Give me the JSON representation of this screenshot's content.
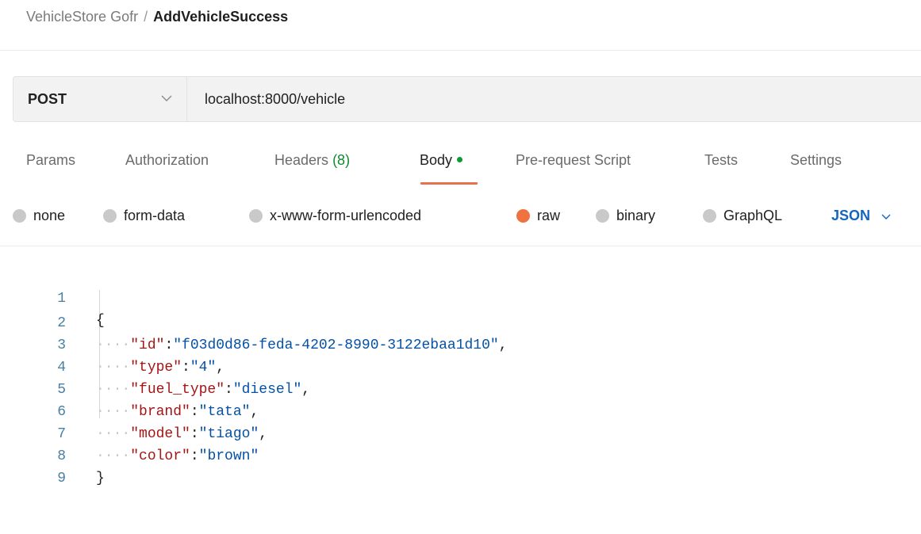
{
  "breadcrumb": {
    "collection": "VehicleStore Gofr",
    "separator": "/",
    "request_name": "AddVehicleSuccess"
  },
  "request": {
    "method": "POST",
    "method_dropdown_icon": "chevron-down-icon",
    "url": "localhost:8000/vehicle"
  },
  "tabs": {
    "params": "Params",
    "authorization": "Authorization",
    "headers_label": "Headers",
    "headers_count": "(8)",
    "body": "Body",
    "pre_request_script": "Pre-request Script",
    "tests": "Tests",
    "settings": "Settings",
    "active": "Body"
  },
  "body_types": {
    "none": "none",
    "form_data": "form-data",
    "x_www_form_urlencoded": "x-www-form-urlencoded",
    "raw": "raw",
    "binary": "binary",
    "graphql": "GraphQL",
    "selected": "raw",
    "format": "JSON"
  },
  "colors": {
    "accent_orange": "#f07240",
    "json_blue": "#1565c0",
    "headers_count_green": "#0e8a2f",
    "json_key": "#a31515",
    "json_string": "#0451a5",
    "line_number": "#4a7fa3"
  },
  "editor": {
    "line_numbers": [
      "1",
      "2",
      "3",
      "4",
      "5",
      "6",
      "7",
      "8",
      "9"
    ],
    "open_brace": "{",
    "close_brace": "}",
    "indent_guide": "····",
    "fields": [
      {
        "key": "\"id\"",
        "value": "\"f03d0d86-feda-4202-8990-3122ebaa1d10\"",
        "trailing": ","
      },
      {
        "key": "\"type\"",
        "value": "\"4\"",
        "trailing": ","
      },
      {
        "key": "\"fuel_type\"",
        "value": "\"diesel\"",
        "trailing": ","
      },
      {
        "key": "\"brand\"",
        "value": "\"tata\"",
        "trailing": ","
      },
      {
        "key": "\"model\"",
        "value": "\"tiago\"",
        "trailing": ","
      },
      {
        "key": "\"color\"",
        "value": "\"brown\"",
        "trailing": ""
      }
    ],
    "colon": ":"
  }
}
